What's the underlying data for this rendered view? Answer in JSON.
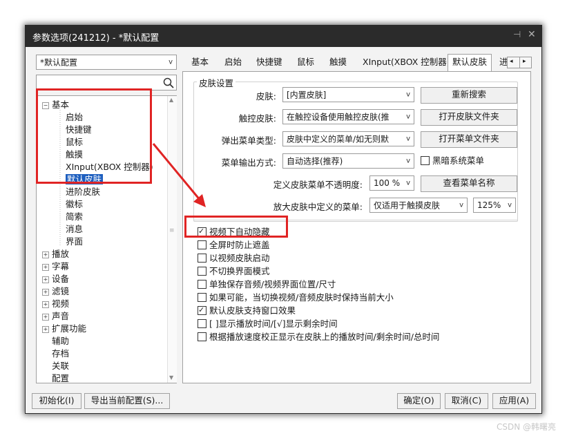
{
  "window": {
    "title": "参数选项(241212) - *默认配置",
    "pin_icon": "pin-icon",
    "close_icon": "close-icon"
  },
  "profile_select": {
    "value": "*默认配置"
  },
  "tree": {
    "items": [
      {
        "label": "基本",
        "type": "collapse"
      },
      {
        "label": "启始"
      },
      {
        "label": "快捷键"
      },
      {
        "label": "鼠标"
      },
      {
        "label": "触摸"
      },
      {
        "label": "XInput(XBOX 控制器)"
      },
      {
        "label": "默认皮肤",
        "selected": true
      },
      {
        "label": "进阶皮肤"
      },
      {
        "label": "徽标"
      },
      {
        "label": "简索"
      },
      {
        "label": "消息"
      },
      {
        "label": "界面"
      },
      {
        "label": "播放",
        "type": "expand"
      },
      {
        "label": "字幕",
        "type": "expand"
      },
      {
        "label": "设备",
        "type": "expand"
      },
      {
        "label": "滤镜",
        "type": "expand"
      },
      {
        "label": "视频",
        "type": "expand"
      },
      {
        "label": "声音",
        "type": "expand"
      },
      {
        "label": "扩展功能",
        "type": "expand"
      },
      {
        "label": "辅助"
      },
      {
        "label": "存档"
      },
      {
        "label": "关联"
      },
      {
        "label": "配置"
      }
    ]
  },
  "tabs": [
    "基本",
    "启始",
    "快捷键",
    "鼠标",
    "触摸",
    "XInput(XBOX 控制器)",
    "默认皮肤",
    "进"
  ],
  "active_tab": "默认皮肤",
  "skin": {
    "group_title": "皮肤设置",
    "skin_label": "皮肤:",
    "skin_value": "[内置皮肤]",
    "touch_label": "触控皮肤:",
    "touch_value": "在触控设备使用触控皮肤(推",
    "popup_label": "弹出菜单类型:",
    "popup_value": "皮肤中定义的菜单/如无则默",
    "menu_out_label": "菜单输出方式:",
    "menu_out_value": "自动选择(推荐)",
    "opacity_label": "定义皮肤菜单不透明度:",
    "opacity_value": "100 %",
    "enlarge_label": "放大皮肤中定义的菜单:",
    "enlarge_value": "仅适用于触摸皮肤",
    "enlarge_scale": "125%",
    "btn_research": "重新搜索",
    "btn_open_skin_folder": "打开皮肤文件夹",
    "btn_open_menu_folder": "打开菜单文件夹",
    "btn_view_menu_names": "查看菜单名称",
    "dark_menu_label": "黑暗系统菜单"
  },
  "options": [
    {
      "label": "视频下自动隐藏",
      "checked": true
    },
    {
      "label": "全屏时防止遮盖",
      "checked": false
    },
    {
      "label": "以视频皮肤启动",
      "checked": false
    },
    {
      "label": "不切换界面模式",
      "checked": false
    },
    {
      "label": "单独保存音频/视频界面位置/尺寸",
      "checked": false
    },
    {
      "label": "如果可能，当切换视频/音频皮肤时保持当前大小",
      "checked": false
    },
    {
      "label": "默认皮肤支持窗口效果",
      "checked": true
    },
    {
      "label": "[ ]显示播放时间/[√]显示剩余时间",
      "checked": false
    },
    {
      "label": "根据播放速度校正显示在皮肤上的播放时间/剩余时间/总时间",
      "checked": false
    }
  ],
  "footer": {
    "init": "初始化(I)",
    "export": "导出当前配置(S)...",
    "ok": "确定(O)",
    "cancel": "取消(C)",
    "apply": "应用(A)"
  },
  "watermark": "CSDN @韩曙亮",
  "highlight_color": "#e02424",
  "selection_color": "#1e5fbf"
}
